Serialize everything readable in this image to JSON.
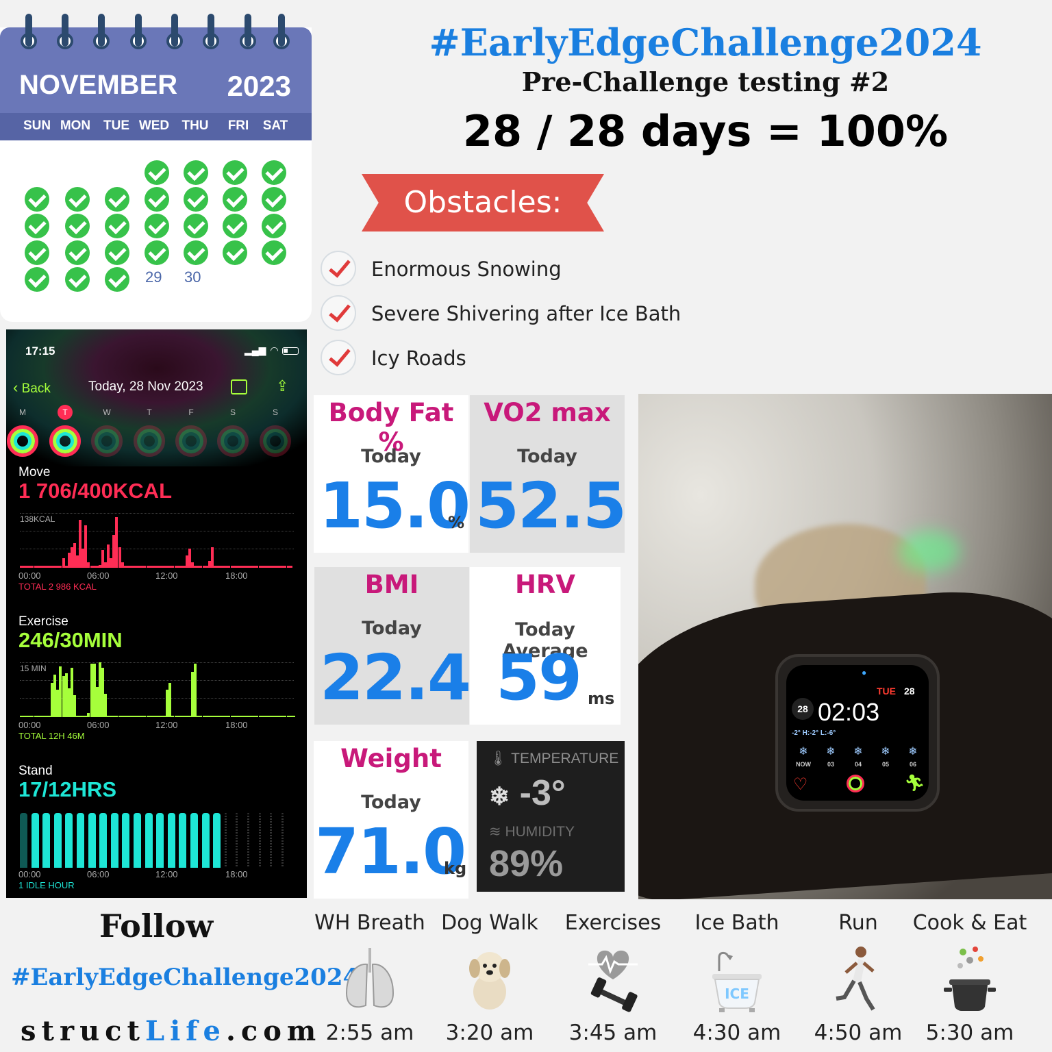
{
  "calendar": {
    "month": "NOVEMBER",
    "year": "2023",
    "weekdays": [
      "SUN",
      "MON",
      "TUE",
      "WED",
      "THU",
      "FRI",
      "SAT"
    ],
    "unchecked_days": [
      "29",
      "30"
    ]
  },
  "header": {
    "hashtag": "#EarlyEdgeChallenge2024",
    "subtitle": "Pre-Challenge testing #2",
    "result": "28 / 28 days = 100%"
  },
  "obstacles": {
    "title": "Obstacles:",
    "items": [
      "Enormous Snowing",
      "Severe Shivering after Ice Bath",
      "Icy Roads"
    ]
  },
  "phone": {
    "time": "17:15",
    "back": "Back",
    "date": "Today, 28 Nov 2023",
    "week_letters": [
      "M",
      "T",
      "W",
      "T",
      "F",
      "S",
      "S"
    ],
    "move_label": "Move",
    "move_value": "1 706/400KCAL",
    "move_scale": "138KCAL",
    "move_total": "TOTAL 2 986 KCAL",
    "exercise_label": "Exercise",
    "exercise_value": "246/30MIN",
    "exercise_scale": "15 MIN",
    "exercise_total": "TOTAL 12H 46M",
    "stand_label": "Stand",
    "stand_value": "17/12HRS",
    "stand_total": "1 IDLE HOUR",
    "time_ticks": [
      "00:00",
      "06:00",
      "12:00",
      "18:00"
    ],
    "colors": {
      "move": "#ff2d55",
      "exercise": "#a6ff3b",
      "stand": "#1ee6d6"
    }
  },
  "metrics": {
    "body_fat": {
      "title": "Body Fat %",
      "sub": "Today",
      "value": "15.0",
      "unit": "%"
    },
    "vo2": {
      "title": "VO2 max",
      "sub": "Today",
      "value": "52.5"
    },
    "bmi": {
      "title": "BMI",
      "sub": "Today",
      "value": "22.4"
    },
    "hrv": {
      "title": "HRV",
      "sub": "Today Average",
      "value": "59",
      "unit": "ms"
    },
    "weight": {
      "title": "Weight",
      "sub": "Today",
      "value": "71.0",
      "unit": "kg"
    }
  },
  "weather": {
    "temp_label": "TEMPERATURE",
    "temp_value": "-3°",
    "humidity_label": "HUMIDITY",
    "humidity_value": "89%"
  },
  "watch": {
    "day": "TUE",
    "date": "28",
    "time": "02:03",
    "weather_line": "-2° H:-2° L:-6°",
    "hours": [
      "NOW",
      "03",
      "04",
      "05",
      "06"
    ]
  },
  "footer": {
    "follow": "Follow",
    "hashtag": "#EarlyEdgeChallenge2024",
    "site_a": "struct",
    "site_b": "Life",
    "site_c": ".com"
  },
  "activities": [
    {
      "label": "WH Breath",
      "time": "2:55 am",
      "icon": "lungs-icon"
    },
    {
      "label": "Dog Walk",
      "time": "3:20 am",
      "icon": "puppy-icon"
    },
    {
      "label": "Exercises",
      "time": "3:45 am",
      "icon": "dumbbell-heart-icon"
    },
    {
      "label": "Ice Bath",
      "time": "4:30 am",
      "icon": "bathtub-icon",
      "icon_text": "ICE"
    },
    {
      "label": "Run",
      "time": "4:50 am",
      "icon": "runner-icon"
    },
    {
      "label": "Cook & Eat",
      "time": "5:30 am",
      "icon": "cooking-pot-icon"
    }
  ]
}
